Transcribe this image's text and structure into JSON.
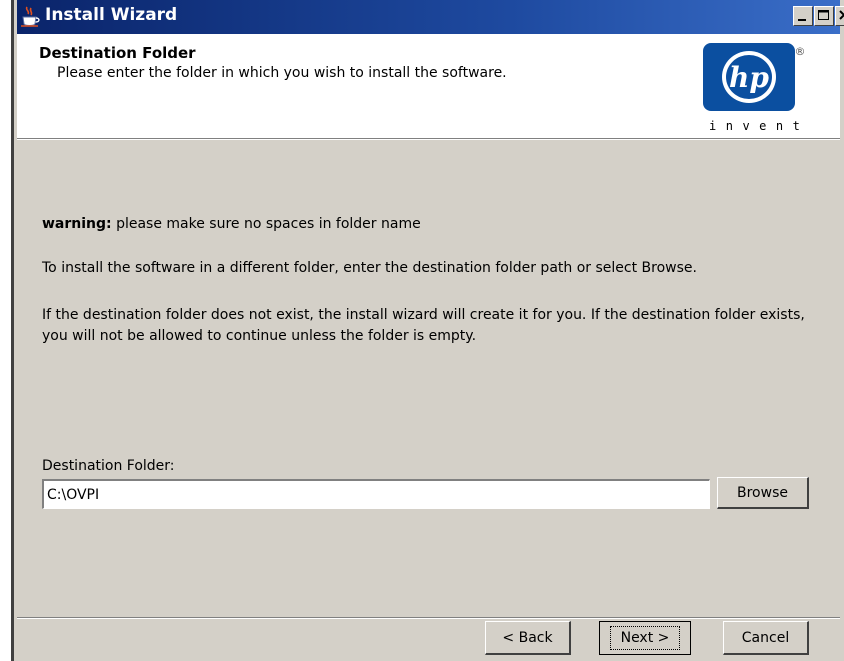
{
  "window": {
    "title": "Install Wizard",
    "accent_color": "#0a246a",
    "icon": "java-cup-icon"
  },
  "header": {
    "title": "Destination Folder",
    "subtitle": "Please enter the folder in which you wish to install the software.",
    "logo_text": "hp",
    "logo_registered": "®",
    "logo_tagline": "invent"
  },
  "body": {
    "warning_label": "warning:",
    "warning_text": " please make sure no spaces in folder name",
    "paragraph1": "To install the software in a different folder, enter the destination folder path or select Browse.",
    "paragraph2": "If the destination folder does not exist, the install wizard will create it for you. If the destination folder exists, you will not be allowed to continue unless the folder is empty.",
    "destination_label": "Destination Folder:",
    "destination_value": "C:\\OVPI",
    "browse_label": "Browse"
  },
  "footer": {
    "back_label": "< Back",
    "next_label": "Next >",
    "cancel_label": "Cancel"
  }
}
